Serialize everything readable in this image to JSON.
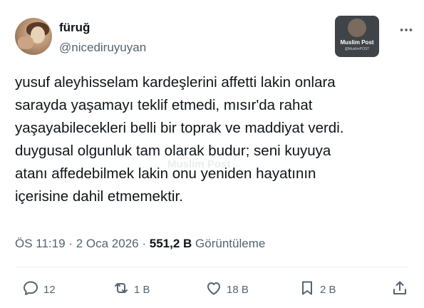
{
  "user": {
    "display_name": "füruğ",
    "username": "@nicediruyuyan"
  },
  "badge": {
    "brand": "Muslim Post",
    "handle": "@MuslimPOST"
  },
  "tweet": {
    "text": "yusuf aleyhisselam kardeşlerini affetti lakin onlara\nsarayda yaşamayı teklif etmedi, mısır'da rahat\nyaşayabilecekleri belli bir toprak ve maddiyat verdi.\nduygusal olgunluk tam olarak budur; seni kuyuya\natanı affedebilmek lakin onu yeniden hayatının\niçerisine dahil etmemektir."
  },
  "watermark": "Muslim Post",
  "meta": {
    "time": "ÖS 11:19",
    "separator": "·",
    "date": "2 Oca 2026",
    "views_count": "551,2 B",
    "views_label": "Görüntüleme"
  },
  "actions": {
    "replies": "12",
    "reposts": "1 B",
    "likes": "18 B",
    "bookmarks": "2 B"
  },
  "icons": {
    "reply": "reply-icon",
    "repost": "repost-icon",
    "like": "heart-icon",
    "bookmark": "bookmark-icon",
    "share": "share-icon",
    "more": "more-icon"
  },
  "colors": {
    "text": "#0f1419",
    "secondary": "#536471",
    "divider": "#eff3f4"
  }
}
